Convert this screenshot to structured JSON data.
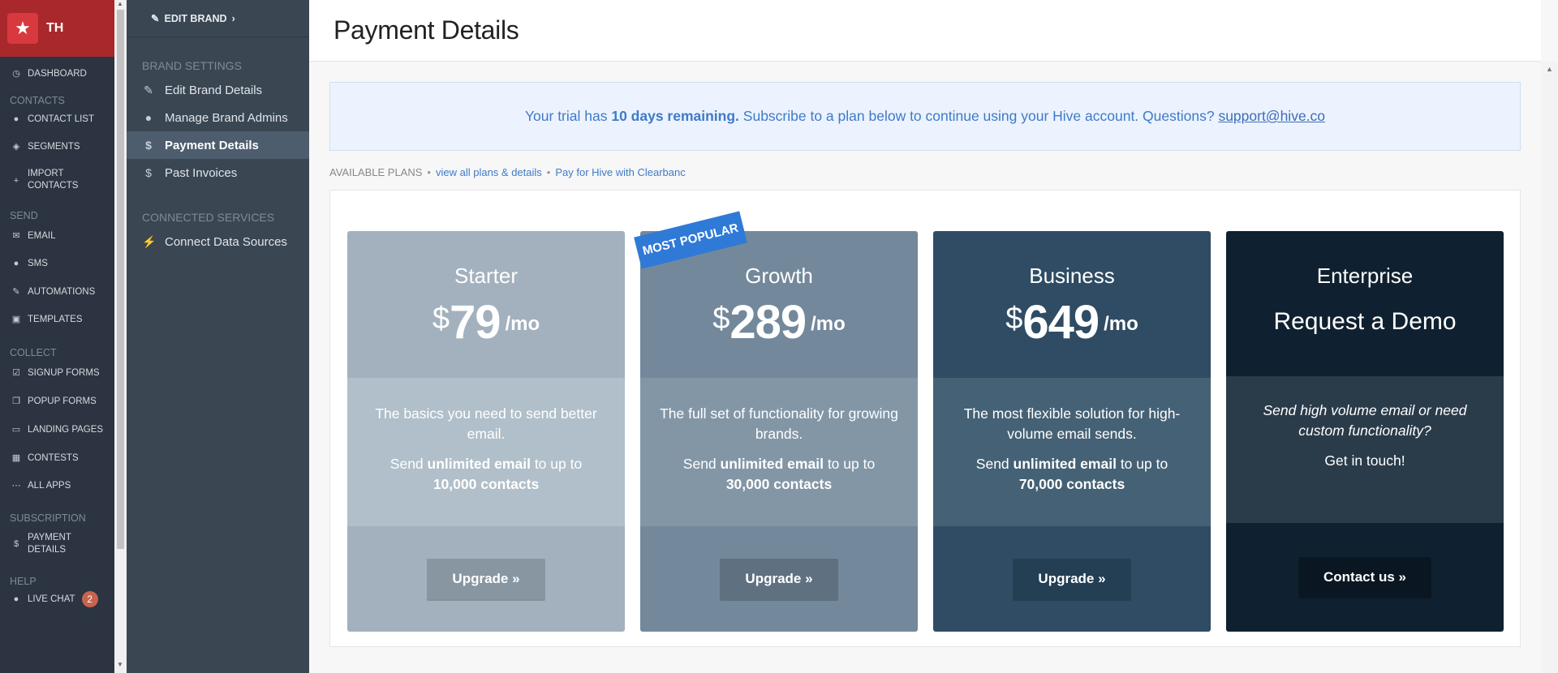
{
  "brand": {
    "initials": "TH"
  },
  "left_nav": {
    "dashboard": "DASHBOARD",
    "contacts_header": "CONTACTS",
    "contact_list": "CONTACT LIST",
    "segments": "SEGMENTS",
    "import_contacts_1": "IMPORT",
    "import_contacts_2": "CONTACTS",
    "send_header": "SEND",
    "email": "EMAIL",
    "sms": "SMS",
    "automations": "AUTOMATIONS",
    "templates": "TEMPLATES",
    "collect_header": "COLLECT",
    "signup_forms": "SIGNUP FORMS",
    "popup_forms": "POPUP FORMS",
    "landing_pages": "LANDING PAGES",
    "contests": "CONTESTS",
    "all_apps": "ALL APPS",
    "subscription_header": "SUBSCRIPTION",
    "payment_details_1": "PAYMENT",
    "payment_details_2": "DETAILS",
    "help_header": "HELP",
    "live_chat": "LIVE CHAT",
    "live_chat_badge": "2"
  },
  "sub_nav": {
    "edit_brand": "EDIT BRAND",
    "brand_settings_header": "BRAND SETTINGS",
    "edit_brand_details": "Edit Brand Details",
    "manage_brand_admins": "Manage Brand Admins",
    "payment_details": "Payment Details",
    "past_invoices": "Past Invoices",
    "connected_services_header": "CONNECTED SERVICES",
    "connect_data_sources": "Connect Data Sources"
  },
  "page": {
    "title": "Payment Details"
  },
  "trial": {
    "prefix": "Your trial has",
    "bold": "10 days remaining.",
    "suffix": "Subscribe to a plan below to continue using your Hive account. Questions?",
    "email": "support@hive.co"
  },
  "available": {
    "label": "AVAILABLE PLANS",
    "view_all": "view all plans & details",
    "clearbanc": "Pay for Hive with Clearbanc"
  },
  "ribbon": "MOST POPULAR",
  "plans": [
    {
      "name": "Starter",
      "currency": "$",
      "amount": "79",
      "period": "/mo",
      "desc": "The basics you need to send better email.",
      "send_pre": "Send",
      "send_bold": "unlimited email",
      "send_mid": "to up to",
      "send_count": "10,000",
      "send_unit": "contacts",
      "button": "Upgrade »",
      "colors": {
        "top": "#a2b1bd",
        "mid": "#b0bfc9",
        "bot": "#a2b1bd",
        "btn": "#8896a2"
      }
    },
    {
      "name": "Growth",
      "currency": "$",
      "amount": "289",
      "period": "/mo",
      "desc": "The full set of functionality for growing brands.",
      "send_pre": "Send",
      "send_bold": "unlimited email",
      "send_mid": "to up to",
      "send_count": "30,000",
      "send_unit": "contacts",
      "button": "Upgrade »",
      "colors": {
        "top": "#73889b",
        "mid": "#8396a6",
        "bot": "#73889b",
        "btn": "#5f7181"
      }
    },
    {
      "name": "Business",
      "currency": "$",
      "amount": "649",
      "period": "/mo",
      "desc": "The most flexible solution for high-volume email sends.",
      "send_pre": "Send",
      "send_bold": "unlimited email",
      "send_mid": "to up to",
      "send_count": "70,000",
      "send_unit": "contacts",
      "button": "Upgrade »",
      "colors": {
        "top": "#2f4c64",
        "mid": "#456175",
        "bot": "#2f4c64",
        "btn": "#243e53"
      }
    },
    {
      "name": "Enterprise",
      "headline": "Request a Demo",
      "desc_italic": "Send high volume email or need custom functionality?",
      "touch": "Get in touch!",
      "button": "Contact us »",
      "colors": {
        "top": "#0f2130",
        "mid": "#2a3b4a",
        "bot": "#0f2130",
        "btn": "#0a1722"
      }
    }
  ]
}
